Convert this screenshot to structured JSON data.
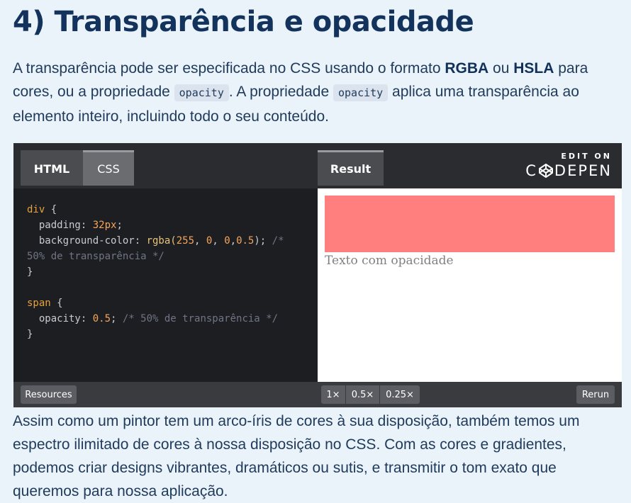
{
  "heading": "4) Transparência e opacidade",
  "intro": {
    "t1": "A transparência pode ser especificada no CSS usando o formato ",
    "b1": "RGBA",
    "t2": " ou ",
    "b2": "HSLA",
    "t3": " para cores, ou a propriedade ",
    "code1": "opacity",
    "t4": ". A propriedade ",
    "code2": "opacity",
    "t5": " aplica uma transparência ao elemento inteiro, incluindo todo o seu conteúdo."
  },
  "codepen": {
    "tabs": {
      "html": "HTML",
      "css": "CSS",
      "result": "Result"
    },
    "edit_on": "EDIT ON",
    "brand_c": "C",
    "brand_rest": "DEPEN",
    "code": {
      "l1_sel": "div",
      "l1_rest": " {",
      "l2_prop": "  padding: ",
      "l2_val": "32px",
      "l2_end": ";",
      "l3_prop": "  background-color: ",
      "l3_fn": "rgba(",
      "l3_a": "255",
      "l3_b": "0",
      "l3_c": "0",
      "l3_d": "0.5",
      "l3_end": "); ",
      "l3_com": "/*",
      "l4_com": "50% de transparência */",
      "l5": "}",
      "l7_sel": "span",
      "l7_rest": " {",
      "l8_prop": "  opacity: ",
      "l8_val": "0.5",
      "l8_end": "; ",
      "l8_com": "/* 50% de transparência */",
      "l9": "}"
    },
    "result_text": "Texto com opacidade",
    "footer": {
      "resources": "Resources",
      "zoom": [
        "1×",
        "0.5×",
        "0.25×"
      ],
      "rerun": "Rerun"
    },
    "colors": {
      "result_box": "#ff8080",
      "editor_bg": "#1d1e22"
    }
  },
  "outro": "Assim como um pintor tem um arco-íris de cores à sua disposição, também temos um espectro ilimitado de cores à nossa disposição no CSS. Com as cores e gradientes, podemos criar designs vibrantes, dramáticos ou sutis, e transmitir o tom exato que queremos para nossa aplicação."
}
